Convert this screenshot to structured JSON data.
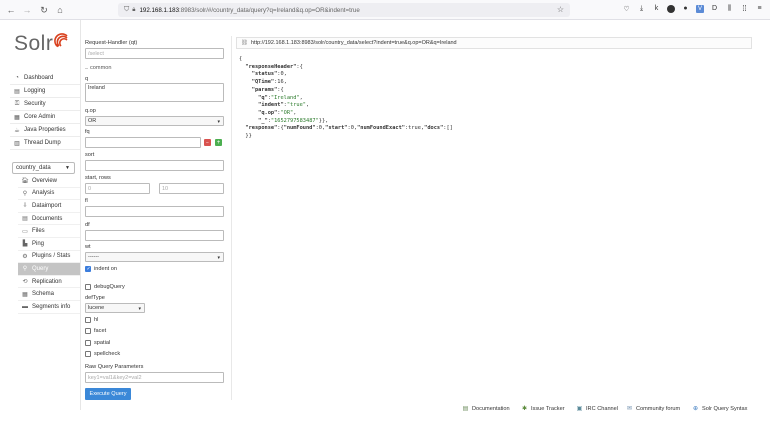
{
  "browser": {
    "url_host": "192.168.1.183",
    "url_rest": ":8983/solr/#/country_data/query?q=Ireland&q.op=OR&indent=true"
  },
  "sidebar": {
    "logo": "Solr",
    "items": [
      {
        "label": "Dashboard",
        "icon": "dashboard-icon"
      },
      {
        "label": "Logging",
        "icon": "logging-icon"
      },
      {
        "label": "Security",
        "icon": "security-icon"
      },
      {
        "label": "Core Admin",
        "icon": "core-admin-icon"
      },
      {
        "label": "Java Properties",
        "icon": "java-icon"
      },
      {
        "label": "Thread Dump",
        "icon": "thread-dump-icon"
      }
    ],
    "core_selector": "country_data",
    "core_items": [
      {
        "label": "Overview",
        "icon": "overview-icon"
      },
      {
        "label": "Analysis",
        "icon": "analysis-icon"
      },
      {
        "label": "Dataimport",
        "icon": "dataimport-icon"
      },
      {
        "label": "Documents",
        "icon": "documents-icon"
      },
      {
        "label": "Files",
        "icon": "files-icon"
      },
      {
        "label": "Ping",
        "icon": "ping-icon"
      },
      {
        "label": "Plugins / Stats",
        "icon": "plugins-icon"
      },
      {
        "label": "Query",
        "icon": "query-icon",
        "active": true
      },
      {
        "label": "Replication",
        "icon": "replication-icon"
      },
      {
        "label": "Schema",
        "icon": "schema-icon"
      },
      {
        "label": "Segments info",
        "icon": "segments-icon"
      }
    ]
  },
  "form": {
    "request_handler_label": "Request-Handler (qt)",
    "request_handler_placeholder": "/select",
    "common_legend": "common",
    "q_label": "q",
    "q_value": "Ireland",
    "qop_label": "q.op",
    "qop_value": "OR",
    "fq_label": "fq",
    "sort_label": "sort",
    "start_rows_label": "start, rows",
    "start_placeholder": "0",
    "rows_placeholder": "10",
    "fl_label": "fl",
    "df_label": "df",
    "wt_label": "wt",
    "wt_value": "------",
    "indent_label": "indent on",
    "debug_label": "debugQuery",
    "deftype_label": "defType",
    "deftype_value": "lucene",
    "hl_label": "hl",
    "facet_label": "facet",
    "spatial_label": "spatial",
    "spellcheck_label": "spellcheck",
    "raw_label": "Raw Query Parameters",
    "raw_placeholder": "key1=val1&key2=val2",
    "execute_label": "Execute Query"
  },
  "result": {
    "url": "http://192.168.1.183:8983/solr/country_data/select?indent=true&q.op=OR&q=Ireland",
    "status": "0",
    "qtime": "16",
    "q": "\"Ireland\"",
    "indent": "\"true\"",
    "qop": "\"OR\"",
    "underscore": "\"1652797583487\"",
    "numfound": "0",
    "start": "0",
    "numfoundexact": "true"
  },
  "footer": {
    "links": [
      {
        "label": "Documentation",
        "icon": "documentation-icon"
      },
      {
        "label": "Issue Tracker",
        "icon": "bug-icon"
      },
      {
        "label": "IRC Channel",
        "icon": "irc-icon"
      },
      {
        "label": "Community forum",
        "icon": "mail-icon"
      },
      {
        "label": "Solr Query Syntax",
        "icon": "syntax-icon"
      }
    ]
  }
}
